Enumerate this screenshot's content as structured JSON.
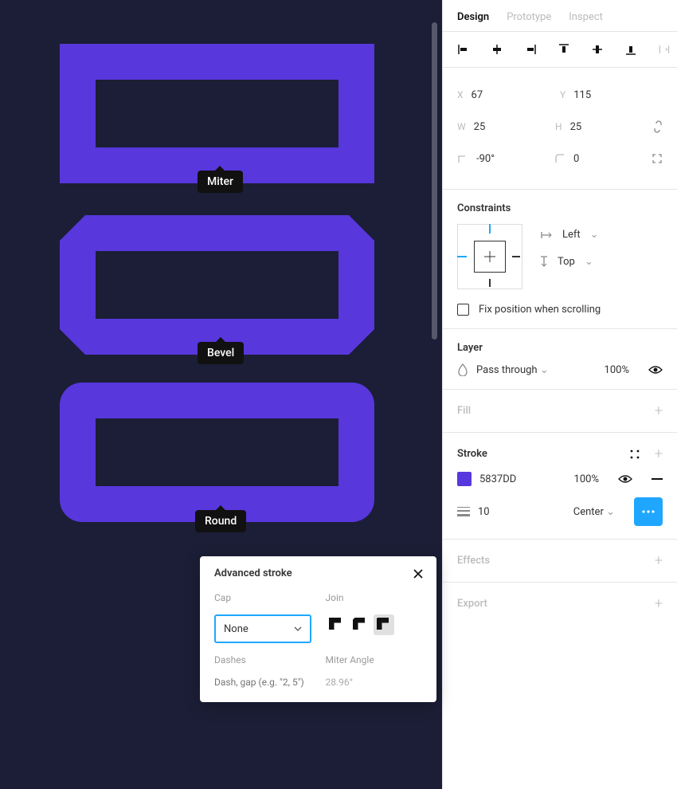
{
  "canvas": {
    "shapes": [
      {
        "label": "Miter"
      },
      {
        "label": "Bevel"
      },
      {
        "label": "Round"
      }
    ]
  },
  "advanced_stroke": {
    "title": "Advanced stroke",
    "cap": {
      "label": "Cap",
      "value": "None"
    },
    "join": {
      "label": "Join",
      "selected": "round"
    },
    "dashes": {
      "label": "Dashes",
      "placeholder": "Dash, gap (e.g. \"2, 5\")"
    },
    "miter": {
      "label": "Miter Angle",
      "value": "28.96°"
    }
  },
  "panel": {
    "tabs": {
      "design": "Design",
      "prototype": "Prototype",
      "inspect": "Inspect",
      "active": "design"
    },
    "transform": {
      "x": {
        "label": "X",
        "value": "67"
      },
      "y": {
        "label": "Y",
        "value": "115"
      },
      "w": {
        "label": "W",
        "value": "25"
      },
      "h": {
        "label": "H",
        "value": "25"
      },
      "rotation": "-90°",
      "radius": "0"
    },
    "constraints": {
      "title": "Constraints",
      "horizontal": "Left",
      "vertical": "Top",
      "fix_label": "Fix position when scrolling",
      "fix_checked": false
    },
    "layer": {
      "title": "Layer",
      "blend": "Pass through",
      "opacity": "100%"
    },
    "fill": {
      "title": "Fill"
    },
    "stroke": {
      "title": "Stroke",
      "color_hex": "5837DD",
      "opacity": "100%",
      "weight": "10",
      "align": "Center"
    },
    "effects": {
      "title": "Effects"
    },
    "export": {
      "title": "Export"
    }
  }
}
